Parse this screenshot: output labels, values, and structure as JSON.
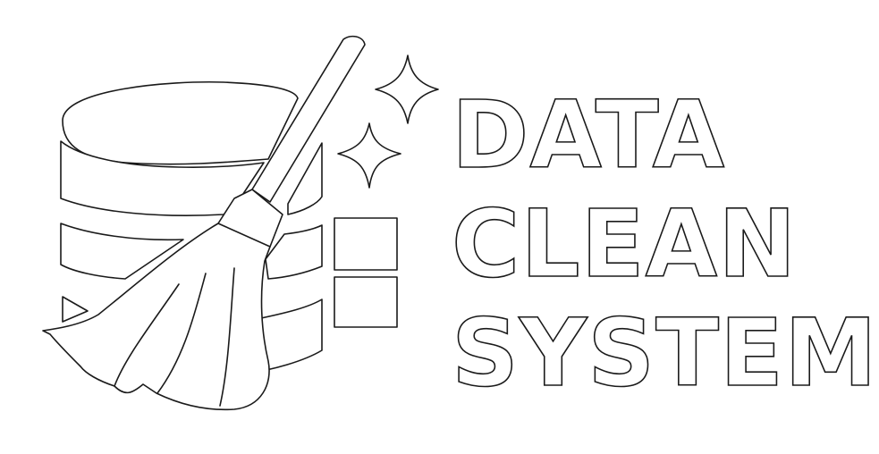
{
  "logo": {
    "words": [
      "DATA",
      "CLEAN",
      "SYSTEM"
    ],
    "colors": {
      "background": "#ffffff",
      "outline": "#1a1a1a",
      "fill": "#ffffff"
    },
    "icons": [
      "database-icon",
      "broom-icon",
      "sparkle-icon",
      "sparkle-icon",
      "block-icon",
      "block-icon"
    ]
  }
}
